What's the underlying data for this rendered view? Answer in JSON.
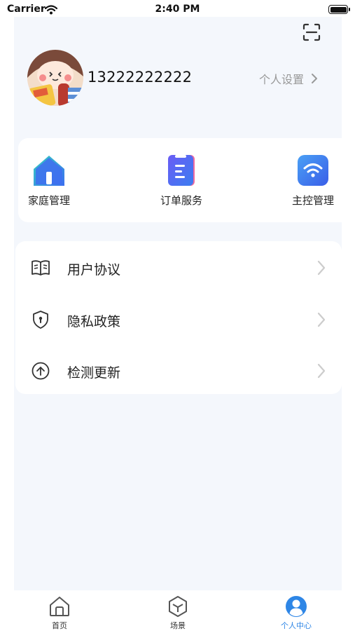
{
  "status_bar": {
    "carrier": "Carrier",
    "time": "2:40 PM"
  },
  "header": {
    "phone": "13222222222",
    "settings_label": "个人设置"
  },
  "quick_actions": [
    {
      "label": "家庭管理",
      "icon": "home-icon"
    },
    {
      "label": "订单服务",
      "icon": "clipboard-icon"
    },
    {
      "label": "主控管理",
      "icon": "wifi-icon"
    }
  ],
  "menu": [
    {
      "label": "用户协议",
      "icon": "book-icon"
    },
    {
      "label": "隐私政策",
      "icon": "shield-icon"
    },
    {
      "label": "检测更新",
      "icon": "upload-circle-icon"
    }
  ],
  "tabs": [
    {
      "label": "首页",
      "icon": "home-outline-icon",
      "active": false
    },
    {
      "label": "场景",
      "icon": "cube-icon",
      "active": false
    },
    {
      "label": "个人中心",
      "icon": "user-circle-icon",
      "active": true
    }
  ],
  "colors": {
    "accent": "#2e86e6",
    "page_bg": "#f4f7fc"
  }
}
